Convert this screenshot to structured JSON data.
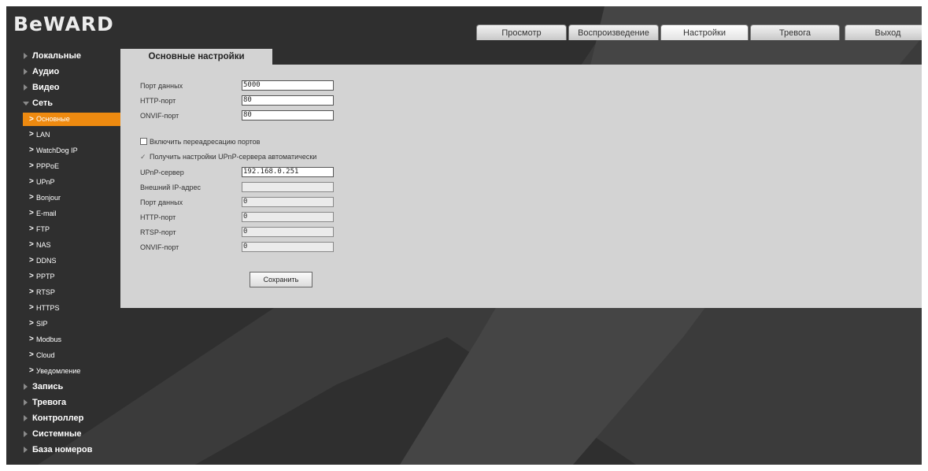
{
  "logo": "BeWARD",
  "tabs": [
    {
      "label": "Просмотр",
      "active": false
    },
    {
      "label": "Воспроизведение",
      "active": false
    },
    {
      "label": "Настройки",
      "active": true
    },
    {
      "label": "Тревога",
      "active": false
    },
    {
      "label": "Выход",
      "active": false
    }
  ],
  "sidebar": {
    "sections": [
      {
        "label": "Локальные",
        "expanded": false
      },
      {
        "label": "Аудио",
        "expanded": false
      },
      {
        "label": "Видео",
        "expanded": false
      },
      {
        "label": "Сеть",
        "expanded": true
      }
    ],
    "network_items": [
      {
        "label": "Основные",
        "active": true
      },
      {
        "label": "LAN"
      },
      {
        "label": "WatchDog IP"
      },
      {
        "label": "PPPoE"
      },
      {
        "label": "UPnP"
      },
      {
        "label": "Bonjour"
      },
      {
        "label": "E-mail"
      },
      {
        "label": "FTP"
      },
      {
        "label": "NAS"
      },
      {
        "label": "DDNS"
      },
      {
        "label": "PPTP"
      },
      {
        "label": "RTSP"
      },
      {
        "label": "HTTPS"
      },
      {
        "label": "SIP"
      },
      {
        "label": "Modbus"
      },
      {
        "label": "Cloud"
      },
      {
        "label": "Уведомление"
      }
    ],
    "bottom_sections": [
      {
        "label": "Запись"
      },
      {
        "label": "Тревога"
      },
      {
        "label": "Контроллер"
      },
      {
        "label": "Системные"
      },
      {
        "label": "База номеров"
      }
    ]
  },
  "content": {
    "tab_title": "Основные настройки",
    "fields": [
      {
        "label": "Порт данных",
        "value": "5000",
        "disabled": false
      },
      {
        "label": "HTTP-порт",
        "value": "80",
        "disabled": false
      },
      {
        "label": "ONVIF-порт",
        "value": "80",
        "disabled": false
      }
    ],
    "checkbox_port_forwarding": {
      "label": "Включить переадресацию портов",
      "checked": false
    },
    "checkbox_upnp_auto": {
      "label": "Получить настройки UPnP-сервера автоматически",
      "checked": true
    },
    "upnp_fields": [
      {
        "label": "UPnP-сервер",
        "value": "192.168.0.251",
        "disabled": false
      },
      {
        "label": "Внешний IP-адрес",
        "value": "",
        "disabled": true
      },
      {
        "label": "Порт данных",
        "value": "0",
        "disabled": true
      },
      {
        "label": "HTTP-порт",
        "value": "0",
        "disabled": true
      },
      {
        "label": "RTSP-порт",
        "value": "0",
        "disabled": true
      },
      {
        "label": "ONVIF-порт",
        "value": "0",
        "disabled": true
      }
    ],
    "save_label": "Сохранить"
  },
  "colors": {
    "background": "#2f2f2f",
    "panel": "#d3d3d3",
    "active_menu": "#ee8a10"
  }
}
